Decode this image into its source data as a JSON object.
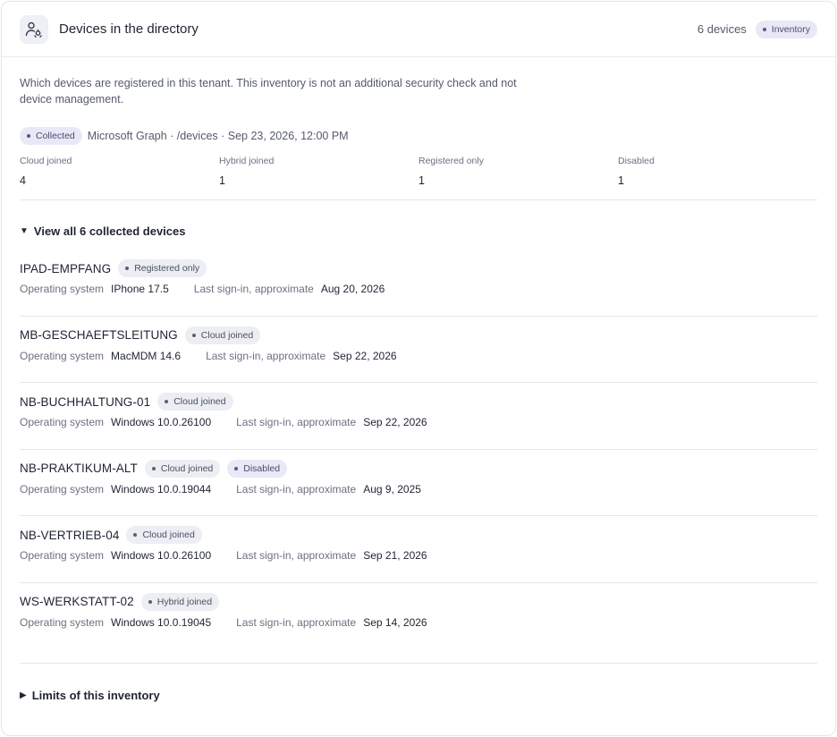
{
  "header": {
    "title": "Devices in the directory",
    "count": "6 devices",
    "badge": "Inventory"
  },
  "description": "Which devices are registered in this tenant. This inventory is not an additional security check and not device management.",
  "source": {
    "badge": "Collected",
    "text": "Microsoft Graph · /devices · Sep 23, 2026, 12:00 PM"
  },
  "stats": [
    {
      "label": "Cloud joined",
      "value": "4"
    },
    {
      "label": "Hybrid joined",
      "value": "1"
    },
    {
      "label": "Registered only",
      "value": "1"
    },
    {
      "label": "Disabled",
      "value": "1"
    }
  ],
  "device_list": {
    "summary": "View all 6 collected devices",
    "os_label": "Operating system",
    "signin_label": "Last sign-in, approximate",
    "devices": [
      {
        "name": "IPAD-EMPFANG",
        "join": "Registered only",
        "status": "",
        "os": "IPhone 17.5",
        "last_signin": "Aug 20, 2026"
      },
      {
        "name": "MB-GESCHAEFTSLEITUNG",
        "join": "Cloud joined",
        "status": "",
        "os": "MacMDM 14.6",
        "last_signin": "Sep 22, 2026"
      },
      {
        "name": "NB-BUCHHALTUNG-01",
        "join": "Cloud joined",
        "status": "",
        "os": "Windows 10.0.26100",
        "last_signin": "Sep 22, 2026"
      },
      {
        "name": "NB-PRAKTIKUM-ALT",
        "join": "Cloud joined",
        "status": "Disabled",
        "os": "Windows 10.0.19044",
        "last_signin": "Aug 9, 2025"
      },
      {
        "name": "NB-VERTRIEB-04",
        "join": "Cloud joined",
        "status": "",
        "os": "Windows 10.0.26100",
        "last_signin": "Sep 21, 2026"
      },
      {
        "name": "WS-WERKSTATT-02",
        "join": "Hybrid joined",
        "status": "",
        "os": "Windows 10.0.19045",
        "last_signin": "Sep 14, 2026"
      }
    ]
  },
  "limits": {
    "summary": "Limits of this inventory"
  },
  "icons": {
    "header": "devices-user-icon",
    "expanded": "triangle-down-icon",
    "collapsed": "triangle-right-icon"
  }
}
